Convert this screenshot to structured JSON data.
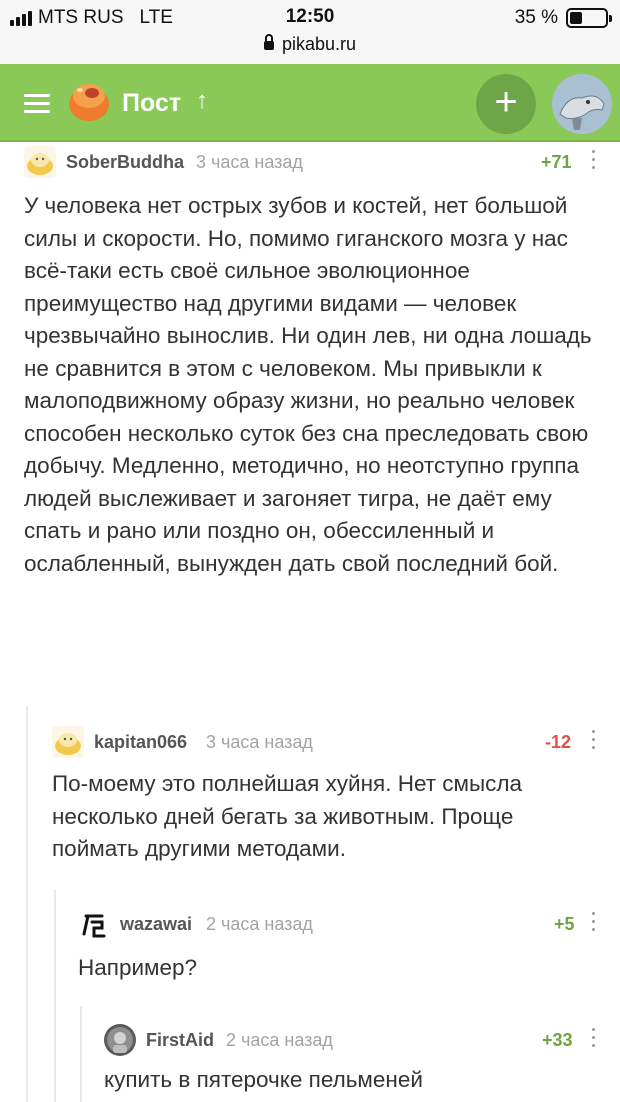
{
  "status_bar": {
    "carrier": "MTS RUS",
    "network": "LTE",
    "time": "12:50",
    "battery": "35 %"
  },
  "url_bar": {
    "domain": "pikabu.ru"
  },
  "header": {
    "title": "Пост",
    "up_icon": "arrow-up-icon",
    "add_icon": "plus-icon",
    "accent": "#8ac858"
  },
  "comments": [
    {
      "author": "SoberBuddha",
      "time": "3 часа назад",
      "score": "+71",
      "text": "У человека нет острых зубов и костей, нет большой силы и скорости. Но, помимо гиганского мозга у нас всё-таки есть своё сильное эволюционное преимущество над другими видами — человек чрезвычайно вынослив. Ни один лев, ни одна лошадь не сравнится в этом с человеком. Мы привыкли к малоподвижному образу жизни, но реально человек способен несколько суток без сна преследовать свою добычу. Медленно, методично, но неотступно группа людей выслеживает и загоняет тигра, не даёт ему спать и рано или поздно он, обессиленный и ослабленный, вынужден дать свой последний бой."
    },
    {
      "author": "kapitan066",
      "time": "3 часа назад",
      "score": "-12",
      "text": "По-моему это полнейшая хуйня. Нет смысла несколько дней бегать за животным. Проще поймать другими методами."
    },
    {
      "author": "wazawai",
      "time": "2 часа назад",
      "score": "+5",
      "text": "Например?"
    },
    {
      "author": "FirstAid",
      "time": "2 часа назад",
      "score": "+33",
      "text": "купить в пятерочке пельменей"
    }
  ]
}
